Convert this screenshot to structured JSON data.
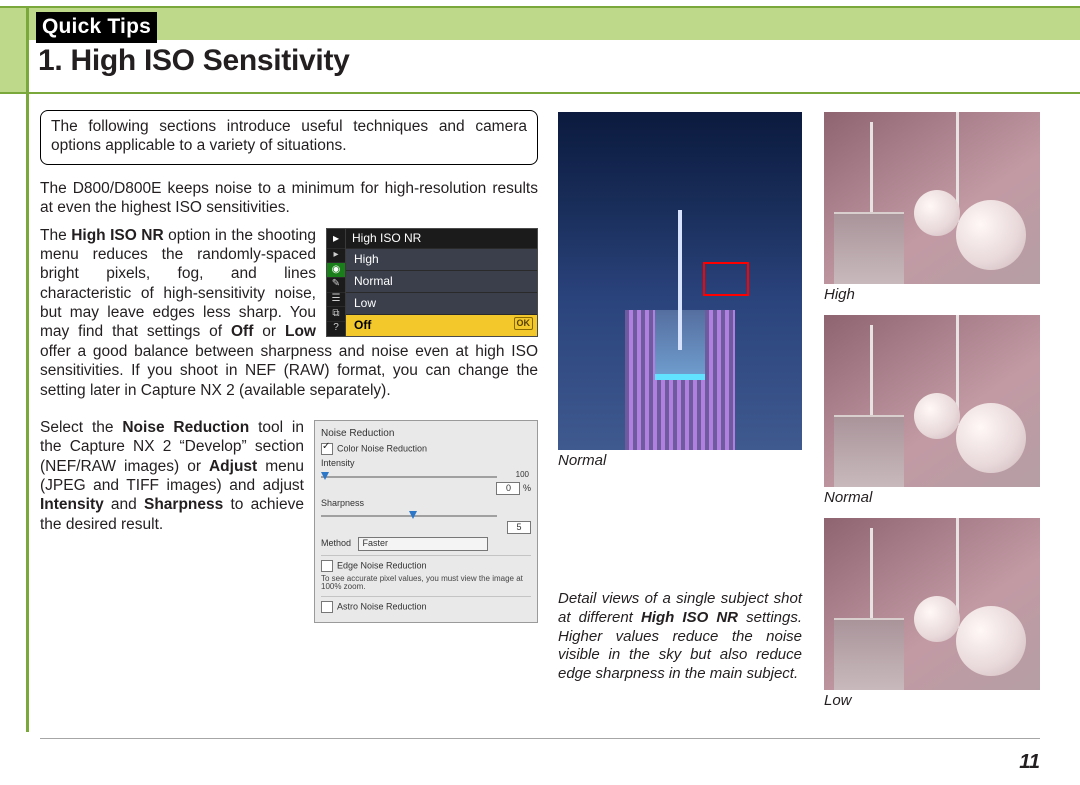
{
  "header": {
    "eyebrow": "Quick Tips",
    "title": "1. High ISO Sensitivity"
  },
  "intro_box": "The following sections introduce useful techniques and camera options applicable to a variety of situations.",
  "para_noise": "The D800/D800E keeps noise to a minimum for high-resolu­tion results at even the highest ISO sensitivities.",
  "para_nr": {
    "lead": "The ",
    "bold1": "High ISO NR",
    "mid1": " option in the shooting menu reduces the ran­domly-spaced bright pixels, fog, and lines characteristic of high-sensitivity noise, but may leave edges less sharp. You may find that settings of ",
    "bold2": "Off",
    "mid2": " or ",
    "bold3": "Low",
    "tail": " offer a good balance between sharpness and noise even at high ISO sensitivities. If you shoot in NEF (RAW) format, you can change the setting later in Capture NX 2 (available separately)."
  },
  "para_nx": {
    "lead": "Select the ",
    "bold1": "Noise Reduction",
    "mid1": " tool in the Capture NX 2 “Develop” sec­tion (NEF/RAW images) or ",
    "bold2": "Adjust",
    "mid2": " menu (JPEG and TIFF images) and adjust ",
    "bold3": "Intensity",
    "mid3": " and ",
    "bold4": "Sharpness",
    "tail": " to achieve the desired result."
  },
  "camera_menu": {
    "title": "High ISO NR",
    "items": [
      "High",
      "Normal",
      "Low",
      "Off"
    ],
    "selected": "Off",
    "ok_label": "OK"
  },
  "nx_panel": {
    "title": "Noise Reduction",
    "color_nr": "Color Noise Reduction",
    "intensity_label": "Intensity",
    "intensity_value": "0",
    "intensity_unit": "%",
    "intensity_max": "100",
    "sharpness_label": "Sharpness",
    "sharpness_value": "5",
    "method_label": "Method",
    "method_value": "Faster",
    "edge_nr": "Edge Noise Reduction",
    "note": "To see accurate pixel values, you must view the image at 100% zoom.",
    "astro": "Astro Noise Reduction"
  },
  "mid": {
    "main_label": "Normal",
    "caption_lead": "Detail views of a single subject shot at different ",
    "caption_bold": "High ISO NR",
    "caption_tail": " settings. Higher values reduce the noise visible in the sky but also reduce edge sharpness in the main subject."
  },
  "right_labels": [
    "High",
    "Normal",
    "Low"
  ],
  "page_number": "11"
}
